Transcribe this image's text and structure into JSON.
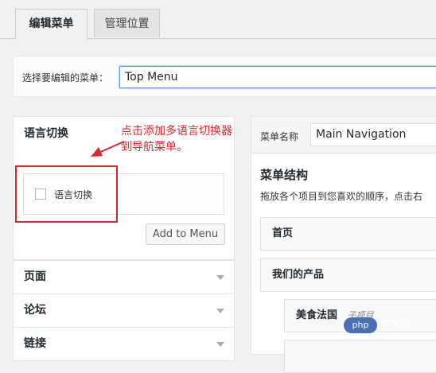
{
  "tabs": [
    {
      "label": "编辑菜单",
      "active": true
    },
    {
      "label": "管理位置",
      "active": false
    }
  ],
  "menu_select": {
    "label": "选择要编辑的菜单：",
    "value": "Top Menu"
  },
  "left_panel": {
    "title": "语言切换",
    "checkbox_label": "语言切换",
    "checked": false,
    "add_button": "Add to Menu",
    "accordions": [
      "页面",
      "论坛",
      "链接"
    ]
  },
  "annotation": {
    "line1": "点击添加多语言切换器",
    "line2": "到导航菜单。",
    "color": "#e0252b"
  },
  "right_panel": {
    "name_label": "菜单名称",
    "name_value": "Main Navigation",
    "structure_title": "菜单结构",
    "structure_desc": "拖放各个项目到您喜欢的顺序，点击右",
    "items": [
      {
        "label": "首页",
        "sub": ""
      },
      {
        "label": "我们的产品",
        "sub": ""
      },
      {
        "label": "美食法国",
        "sub": "子项目"
      }
    ]
  },
  "watermark": {
    "logo": "php",
    "text": "中文网"
  }
}
